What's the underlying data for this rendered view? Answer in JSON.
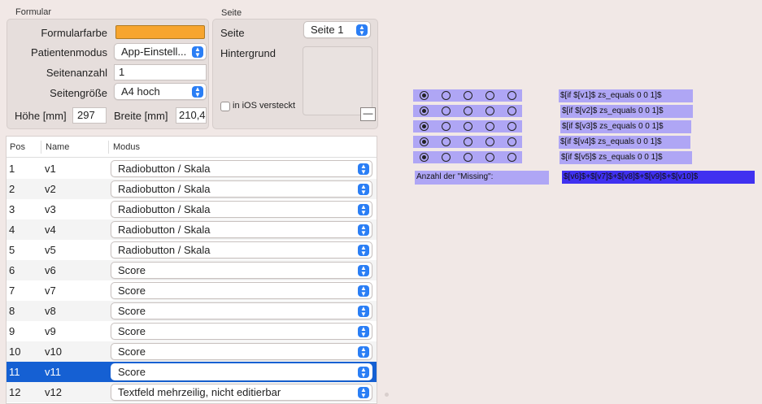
{
  "formular": {
    "group_label": "Formular",
    "farbe_label": "Formularfarbe",
    "farbe_color": "#f7a52e",
    "patientenmodus_label": "Patientenmodus",
    "patientenmodus_value": "App-Einstell...",
    "seitenanzahl_label": "Seitenanzahl",
    "seitenanzahl_value": "1",
    "seitengroesse_label": "Seitengröße",
    "seitengroesse_value": "A4 hoch",
    "hoehe_label": "Höhe [mm]",
    "hoehe_value": "297",
    "breite_label": "Breite [mm]",
    "breite_value": "210,4"
  },
  "seite": {
    "group_label": "Seite",
    "seite_label": "Seite",
    "seite_value": "Seite 1",
    "hintergrund_label": "Hintergrund",
    "ios_label": "in iOS versteckt",
    "minus_label": "—"
  },
  "table": {
    "headers": {
      "pos": "Pos",
      "name": "Name",
      "modus": "Modus"
    },
    "selected_row": 11,
    "rows": [
      {
        "pos": "1",
        "name": "v1",
        "modus": "Radiobutton / Skala"
      },
      {
        "pos": "2",
        "name": "v2",
        "modus": "Radiobutton / Skala"
      },
      {
        "pos": "3",
        "name": "v3",
        "modus": "Radiobutton / Skala"
      },
      {
        "pos": "4",
        "name": "v4",
        "modus": "Radiobutton / Skala"
      },
      {
        "pos": "5",
        "name": "v5",
        "modus": "Radiobutton / Skala"
      },
      {
        "pos": "6",
        "name": "v6",
        "modus": "Score"
      },
      {
        "pos": "7",
        "name": "v7",
        "modus": "Score"
      },
      {
        "pos": "8",
        "name": "v8",
        "modus": "Score"
      },
      {
        "pos": "9",
        "name": "v9",
        "modus": "Score"
      },
      {
        "pos": "10",
        "name": "v10",
        "modus": "Score"
      },
      {
        "pos": "11",
        "name": "v11",
        "modus": "Score"
      },
      {
        "pos": "12",
        "name": "v12",
        "modus": "Textfeld mehrzeilig, nicht editierbar"
      }
    ]
  },
  "preview": {
    "radio_rows": [
      {
        "selected_index": 0,
        "formula": "$[if $[v1]$ zs_equals 0 0 1]$"
      },
      {
        "selected_index": 0,
        "formula": "$[if $[v2]$ zs_equals 0 0 1]$"
      },
      {
        "selected_index": 0,
        "formula": "$[if $[v3]$ zs_equals 0 0 1]$"
      },
      {
        "selected_index": 0,
        "formula": "$[if $[v4]$ zs_equals 0 0 1]$"
      },
      {
        "selected_index": 0,
        "formula": "$[if $[v5]$ zs_equals 0 0 1]$"
      }
    ],
    "missing_label": "Anzahl der \"Missing\":",
    "missing_formula": "$[v6]$+$[v7]$+$[v8]$+$[v9]$+$[v10]$",
    "bar_color": "#afa6f5",
    "highlight_color": "#4031f0"
  }
}
